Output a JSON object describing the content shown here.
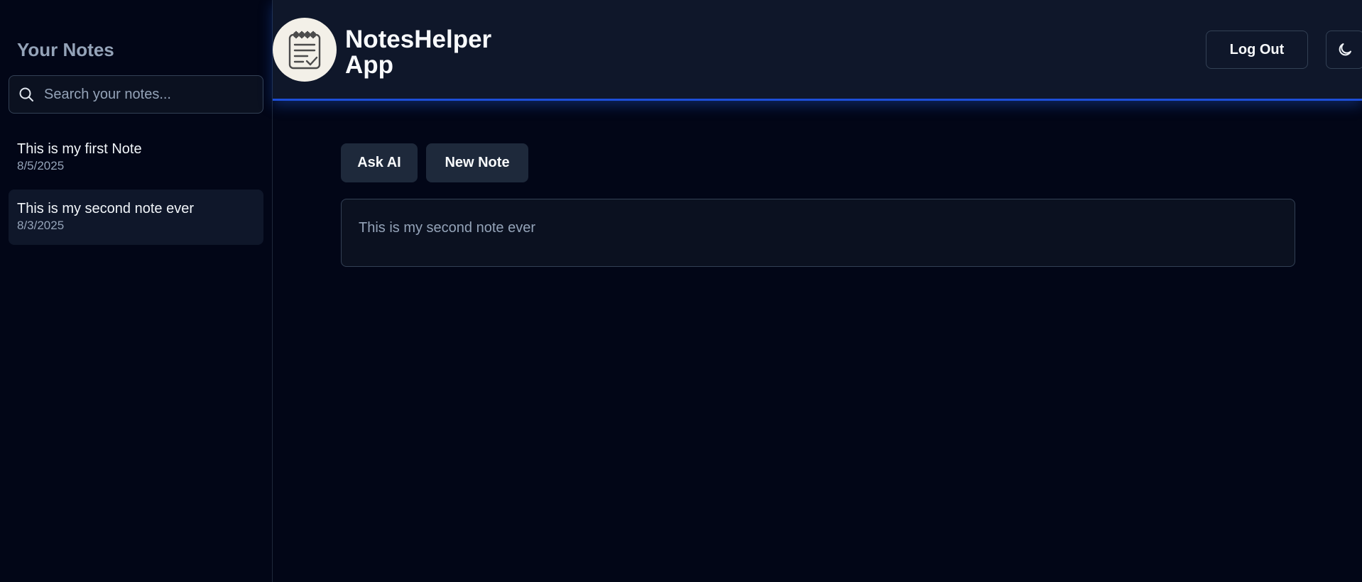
{
  "sidebar": {
    "title": "Your Notes",
    "search": {
      "placeholder": "Search your notes...",
      "value": ""
    },
    "notes": [
      {
        "title": "This is my first Note",
        "date": "8/5/2025",
        "active": false
      },
      {
        "title": "This is my second note ever",
        "date": "8/3/2025",
        "active": true
      }
    ]
  },
  "header": {
    "app_title": "NotesHelper App",
    "logo_icon": "notepad-check-icon",
    "logout_label": "Log Out",
    "theme_icon": "moon-icon"
  },
  "main": {
    "ask_ai_label": "Ask AI",
    "new_note_label": "New Note",
    "editor_text": "This is my second note ever"
  },
  "colors": {
    "background": "#020617",
    "header_bg": "#0f172a",
    "accent_glow": "#1d4ed8",
    "button_bg": "#1e293b"
  }
}
